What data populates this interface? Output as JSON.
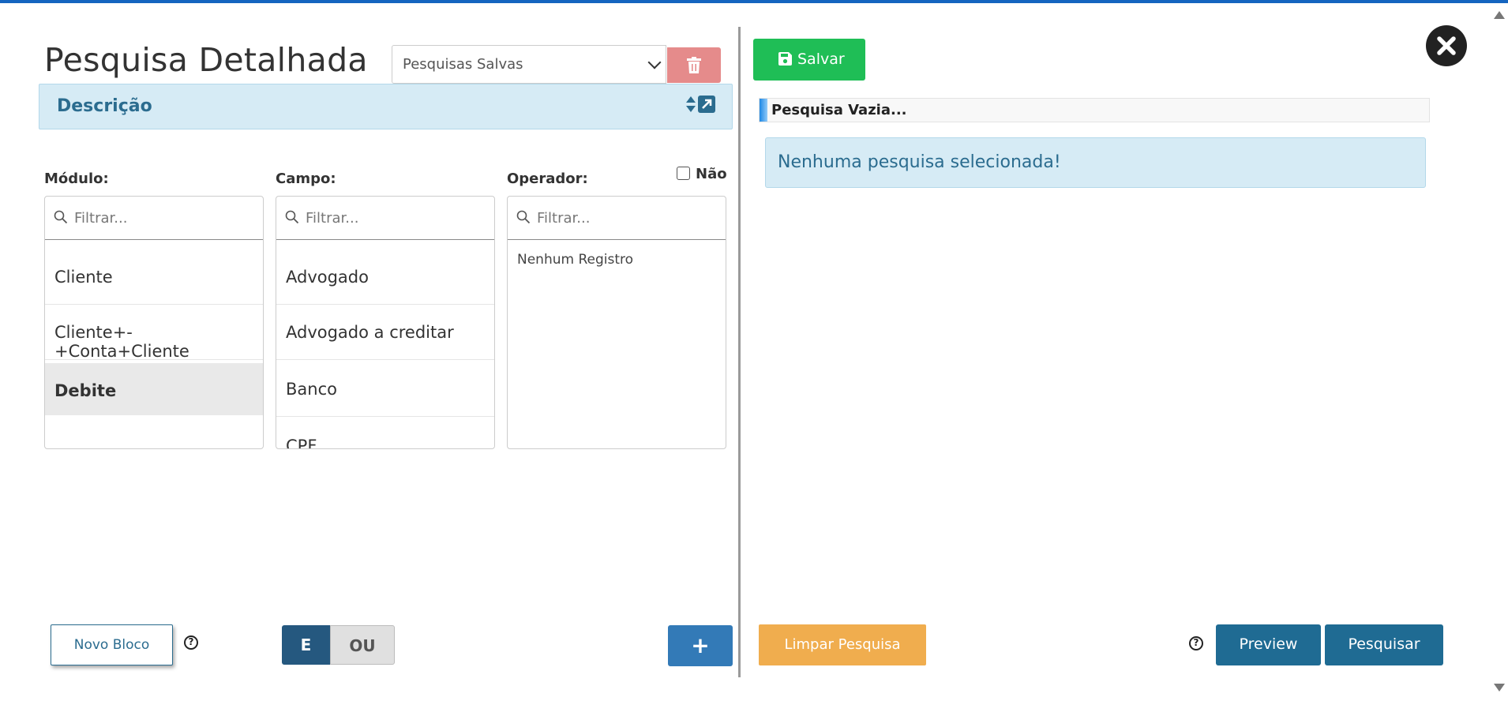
{
  "header": {
    "title": "Pesquisa Detalhada",
    "saved_searches_select": "Pesquisas Salvas"
  },
  "description_bar": {
    "label": "Descrição"
  },
  "filters": {
    "module": {
      "label": "Módulo:",
      "placeholder": "Filtrar...",
      "items": [
        "Cliente",
        "Cliente+-+Conta+Cliente",
        "Debite"
      ],
      "selected": "Debite"
    },
    "field": {
      "label": "Campo:",
      "placeholder": "Filtrar...",
      "items": [
        "Advogado",
        "Advogado a creditar",
        "Banco",
        "CPF"
      ]
    },
    "operator": {
      "label": "Operador:",
      "placeholder": "Filtrar...",
      "empty_text": "Nenhum Registro"
    },
    "negate": {
      "label": "Não",
      "checked": false
    }
  },
  "bottom_left": {
    "new_block_label": "Novo Bloco",
    "help_symbol": "?",
    "logic_and": "E",
    "logic_or": "OU",
    "logic_selected": "E",
    "add_label": "+"
  },
  "right_panel": {
    "save_label": "Salvar",
    "search_title": "Pesquisa Vazia...",
    "info_message": "Nenhuma pesquisa selecionada!",
    "clear_label": "Limpar Pesquisa",
    "help_symbol": "?",
    "preview_label": "Preview",
    "search_label": "Pesquisar"
  },
  "colors": {
    "primary": "#1f6b93",
    "success": "#1fbe56",
    "warning": "#f0ad4e",
    "danger": "#e58b8b",
    "info_bg": "#d6ebf5"
  }
}
